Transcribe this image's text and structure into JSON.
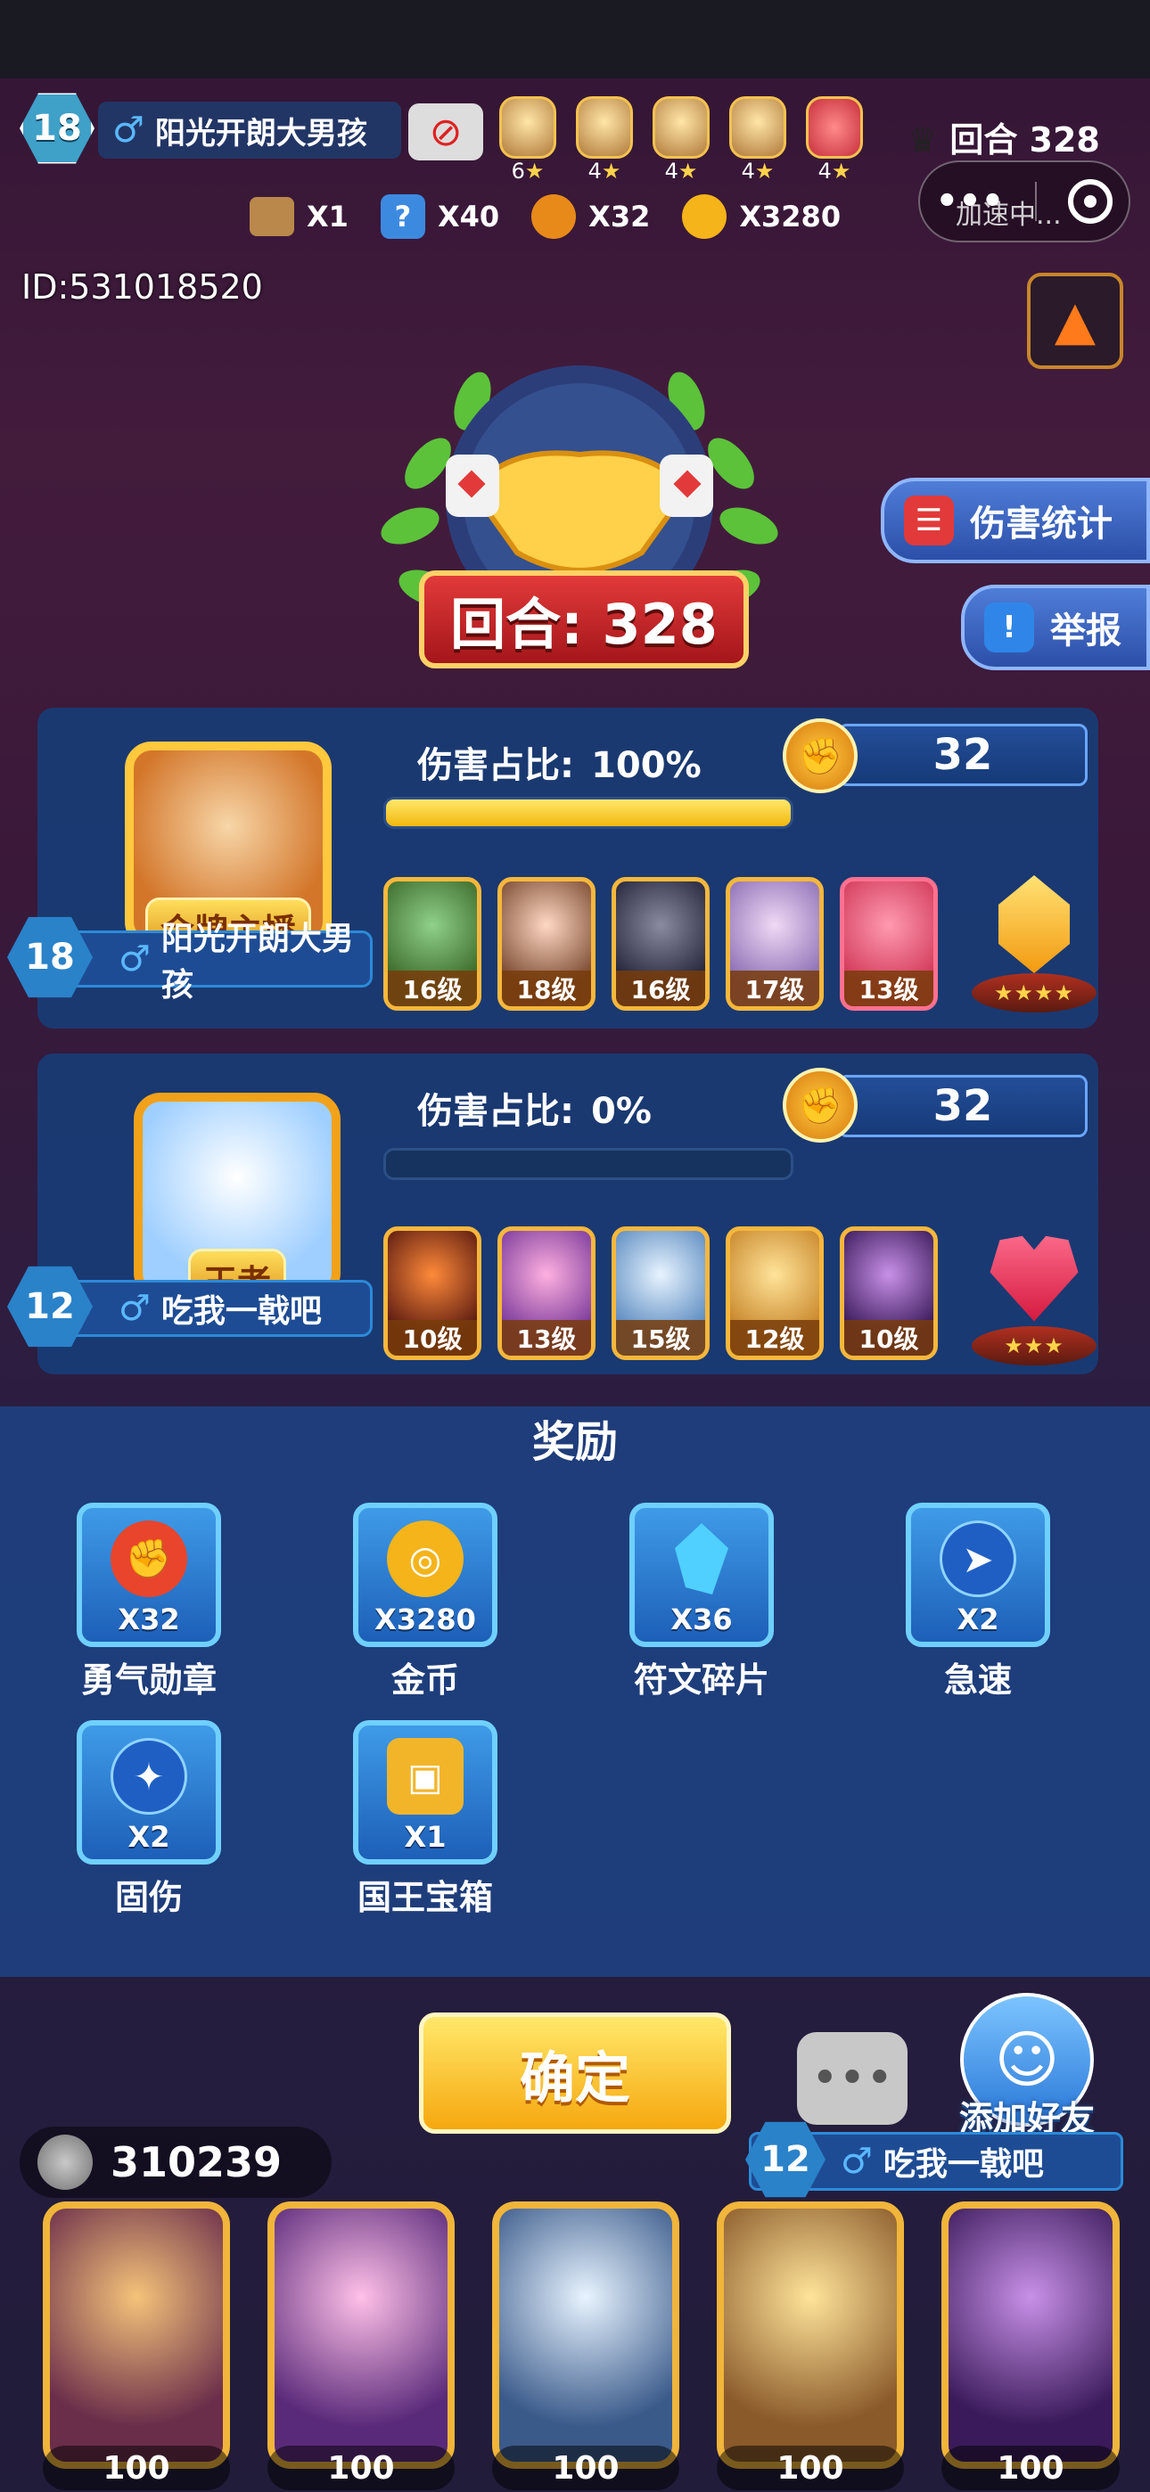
{
  "hud": {
    "player_level": "18",
    "player_name": "阳光开朗大男孩",
    "round_label": "回合 328",
    "heroes": [
      {
        "stars": "6"
      },
      {
        "stars": "4"
      },
      {
        "stars": "4"
      },
      {
        "stars": "4"
      },
      {
        "stars": "4"
      }
    ],
    "resources": [
      {
        "icon": "chest-icon",
        "qty": "X1"
      },
      {
        "icon": "question-icon",
        "qty": "X40"
      },
      {
        "icon": "medal-icon",
        "qty": "X32"
      },
      {
        "icon": "coin-icon",
        "qty": "X3280"
      }
    ],
    "speed_label": "加速中..."
  },
  "player_id": "ID:531018520",
  "round_banner": "回合: 328",
  "side_buttons": {
    "damage_stats": "伤害统计",
    "report": "举报"
  },
  "players": [
    {
      "level": "18",
      "name": "阳光开朗大男孩",
      "title_badge": "金牌主播",
      "damage_label": "伤害占比:",
      "damage_value": "100%",
      "damage_fraction": 1.0,
      "medal_count": "32",
      "heroes": [
        "16级",
        "18级",
        "16级",
        "17级",
        "13级"
      ],
      "gem_stars": "★★★★"
    },
    {
      "level": "12",
      "name": "吃我一戟吧",
      "title_badge": "王者",
      "damage_label": "伤害占比:",
      "damage_value": "0%",
      "damage_fraction": 0.0,
      "medal_count": "32",
      "heroes": [
        "10级",
        "13级",
        "15级",
        "12级",
        "10级"
      ],
      "gem_stars": "★★★"
    }
  ],
  "rewards": {
    "title": "奖励",
    "items": [
      {
        "icon": "courage-medal-icon",
        "qty": "X32",
        "name": "勇气勋章",
        "color": "#e8452c"
      },
      {
        "icon": "gold-coin-icon",
        "qty": "X3280",
        "name": "金币",
        "color": "#f4b41a"
      },
      {
        "icon": "rune-shard-icon",
        "qty": "X36",
        "name": "符文碎片",
        "color": "#4fd0ff"
      },
      {
        "icon": "haste-icon",
        "qty": "X2",
        "name": "急速",
        "color": "#3a7ee8"
      },
      {
        "icon": "fixed-damage-icon",
        "qty": "X2",
        "name": "固伤",
        "color": "#3a7ee8"
      },
      {
        "icon": "king-chest-icon",
        "qty": "X1",
        "name": "国王宝箱",
        "color": "#f2b52a"
      }
    ]
  },
  "confirm_label": "确定",
  "add_friend_label": "添加好友",
  "bottom": {
    "coins": "310239",
    "opponent_level": "12",
    "opponent_name": "吃我一戟吧",
    "hero_costs": [
      "100",
      "100",
      "100",
      "100",
      "100"
    ]
  }
}
